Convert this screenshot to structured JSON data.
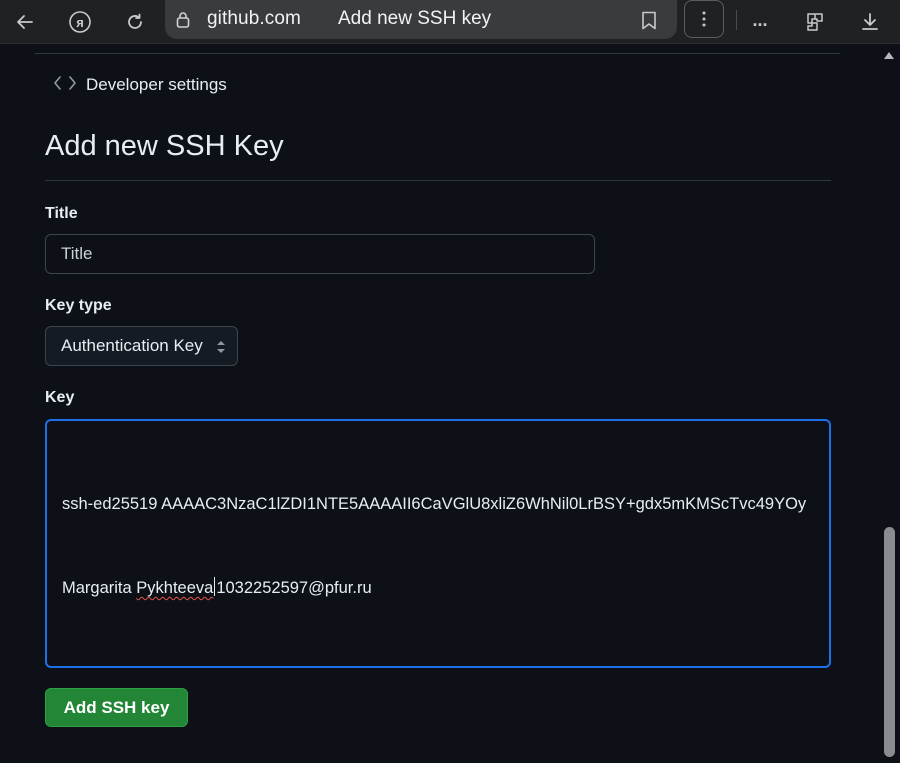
{
  "browser": {
    "domain": "github.com",
    "tab_title": "Add new SSH key",
    "icons": [
      "back-arrow-icon",
      "yandex-logo-icon",
      "reload-icon",
      "lock-icon",
      "bookmark-icon",
      "kebab-menu-icon",
      "more-icon",
      "extensions-icon",
      "download-icon"
    ],
    "more_label": "..."
  },
  "breadcrumb": {
    "label": "Developer settings",
    "icon": "code-icon"
  },
  "page": {
    "title": "Add new SSH Key"
  },
  "form": {
    "title_label": "Title",
    "title_placeholder": "Title",
    "title_value": "",
    "key_type_label": "Key type",
    "key_type_selected": "Authentication Key",
    "key_label": "Key",
    "key_value_line1": "ssh-ed25519 AAAAC3NzaC1lZDI1NTE5AAAAII6CaVGlU8xliZ6WhNil0LrBSY+gdx5mKMScTvc49YOy",
    "key_value_line2_part1": "Margarita ",
    "key_value_line2_misspelled": "Pykhteeva",
    "key_value_line2_part2": "1032252597@pfur.ru",
    "submit_label": "Add SSH key"
  },
  "colors": {
    "background": "#0d1117",
    "accent_focus": "#1f6feb",
    "primary_button": "#238636",
    "border": "#30363d"
  }
}
